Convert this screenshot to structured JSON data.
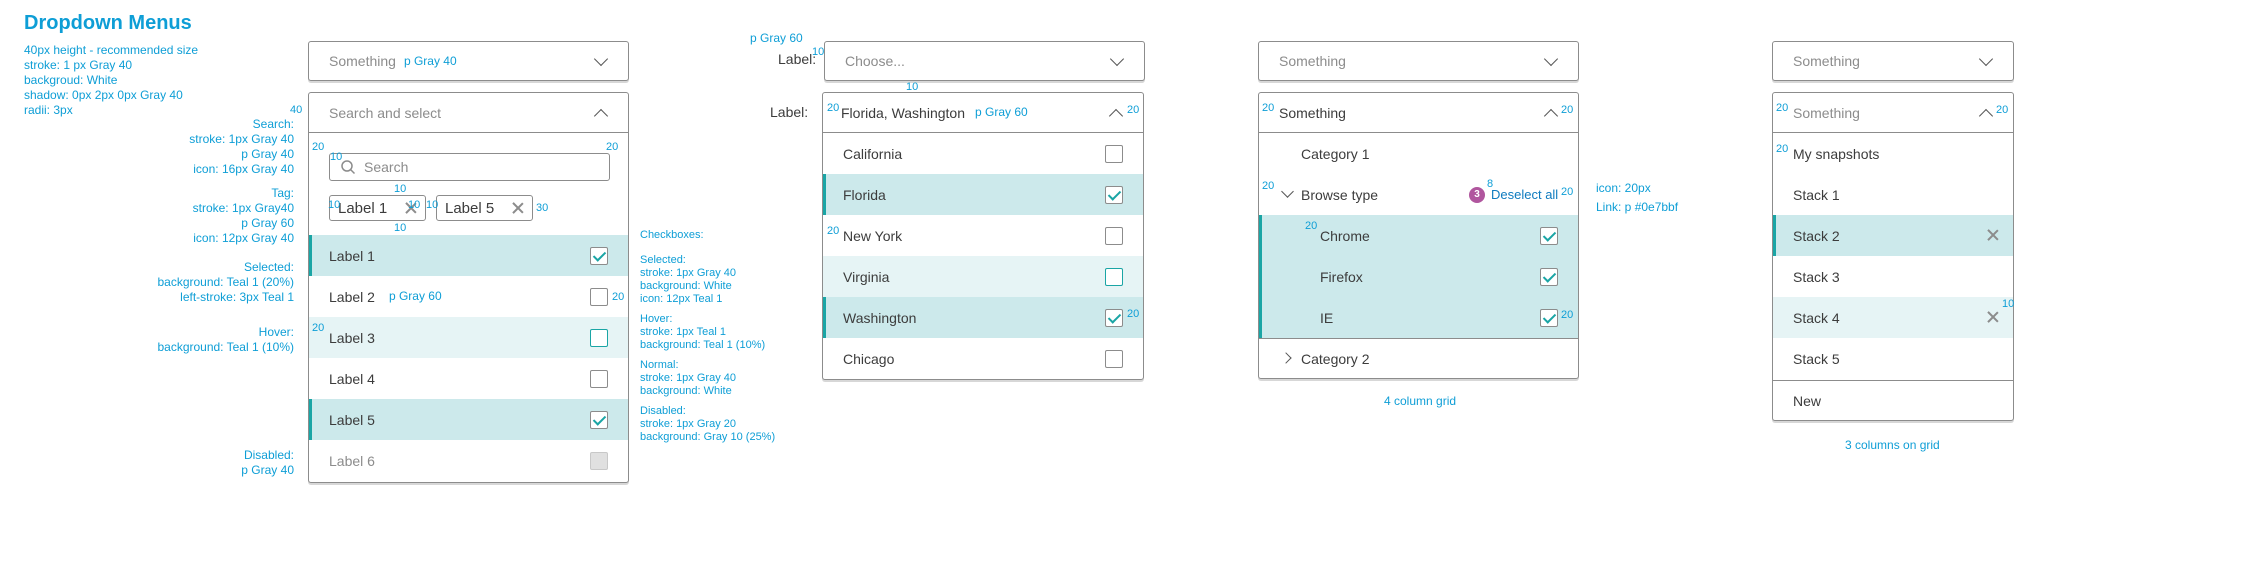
{
  "title": "Dropdown Menus",
  "spec": {
    "lines": [
      "40px height - recommended size",
      "stroke: 1 px Gray 40",
      "backgroud: White",
      "shadow: 0px 2px 0px Gray 40",
      "radii: 3px"
    ]
  },
  "left_notes": {
    "search_h": "Search:",
    "search_lines": [
      "stroke: 1px Gray 40",
      "p Gray 40",
      "icon: 16px Gray 40"
    ],
    "tag_h": "Tag:",
    "tag_lines": [
      "stroke: 1px Gray40",
      "p Gray 60",
      "icon: 12px Gray 40"
    ],
    "selected_h": "Selected:",
    "selected_lines": [
      "background: Teal 1 (20%)",
      "left-stroke: 3px Teal 1"
    ],
    "hover_h": "Hover:",
    "hover_lines": [
      "background: Teal 1 (10%)"
    ],
    "disabled_h": "Disabled:",
    "disabled_lines": [
      "p Gray 40"
    ]
  },
  "checkbox_notes": {
    "title": "Checkboxes:",
    "selected_h": "Selected:",
    "selected_lines": [
      "stroke: 1px Gray 40",
      "background: White",
      "icon: 12px Teal 1"
    ],
    "hover_h": "Hover:",
    "hover_lines": [
      "stroke: 1px Teal 1",
      "background: Teal 1 (10%)"
    ],
    "normal_h": "Normal:",
    "normal_lines": [
      "stroke: 1px Gray 40",
      "background: White"
    ],
    "disabled_h": "Disabled:",
    "disabled_lines": [
      "stroke: 1px Gray 20",
      "background: Gray 10 (25%)"
    ]
  },
  "d1": {
    "closed_placeholder": "Something",
    "closed_note": "p Gray 40",
    "open_placeholder": "Search and select",
    "search_placeholder": "Search",
    "tags": [
      "Label 1",
      "Label 5"
    ],
    "items": [
      {
        "label": "Label 1",
        "state": "sel"
      },
      {
        "label": "Label 2",
        "state": "normal",
        "note": "p Gray 60"
      },
      {
        "label": "Label 3",
        "state": "hov"
      },
      {
        "label": "Label 4",
        "state": "normal"
      },
      {
        "label": "Label 5",
        "state": "sel"
      },
      {
        "label": "Label 6",
        "state": "dis"
      }
    ]
  },
  "d2": {
    "top_note": "p Gray 60",
    "label1": "Label:",
    "closed_placeholder": "Choose...",
    "label2": "Label:",
    "open_value": "Florida, Washington",
    "open_note": "p Gray 60",
    "items": [
      {
        "label": "California",
        "state": "normal"
      },
      {
        "label": "Florida",
        "state": "sel"
      },
      {
        "label": "New York",
        "state": "normal"
      },
      {
        "label": "Virginia",
        "state": "hov"
      },
      {
        "label": "Washington",
        "state": "sel"
      },
      {
        "label": "Chicago",
        "state": "normal"
      }
    ]
  },
  "d3": {
    "closed_placeholder": "Something",
    "open_value": "Something",
    "category1": "Category 1",
    "browse": "Browse type",
    "badge": "3",
    "deselect": "Deselect all",
    "items": [
      "Chrome",
      "Firefox",
      "IE"
    ],
    "category2": "Category 2",
    "note_icon": "icon: 20px",
    "note_link": "Link: p #0e7bbf",
    "grid_note": "4 column grid"
  },
  "d4": {
    "closed_placeholder": "Something",
    "open_placeholder": "Something",
    "items": [
      {
        "label": "My snapshots",
        "state": "normal"
      },
      {
        "label": "Stack 1",
        "state": "normal"
      },
      {
        "label": "Stack 2",
        "state": "sel"
      },
      {
        "label": "Stack 3",
        "state": "normal"
      },
      {
        "label": "Stack 4",
        "state": "hov"
      },
      {
        "label": "Stack 5",
        "state": "normal"
      }
    ],
    "new": "New",
    "grid_note": "3 columns on grid"
  },
  "marks": {
    "twenty": "20",
    "ten": "10",
    "thirty": "30",
    "forty": "40",
    "eight": "8"
  },
  "colors": {
    "teal": "#1aa5a5",
    "annotation": "#0e9ed6",
    "gray40": "#8c8c8c",
    "selected_bg": "#cce9eb",
    "hover_bg": "#e6f4f5",
    "badge": "#b0569e"
  }
}
